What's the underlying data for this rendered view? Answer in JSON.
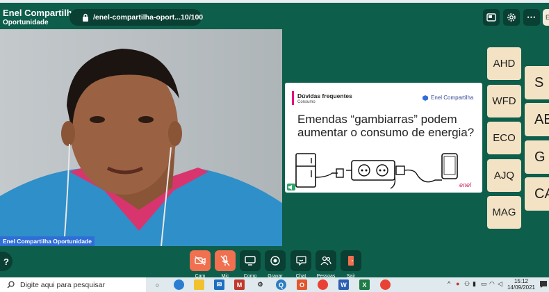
{
  "header": {
    "brand_title": "Enel Compartilha",
    "brand_subtitle": "Oportunidade",
    "url": "/enel-compartilha-oport...",
    "participant_count": "10/100",
    "edge_button_label": "E"
  },
  "video": {
    "name_tag": "Enel Compartilha Oportunidade"
  },
  "slide": {
    "section": "Dúvidas frequentes",
    "category": "Consumo",
    "logo_text": "Enel Compartilha",
    "heading": "Emendas “gambiarras” podem aumentar o consumo de energia?",
    "brand": "enel"
  },
  "participants": {
    "column1": [
      "AHD",
      "WFD",
      "ECO",
      "AJQ",
      "MAG"
    ],
    "column2": [
      "S",
      "AE",
      "G",
      "CA"
    ]
  },
  "controls": {
    "help": "?",
    "labels": [
      "Cam",
      "Mic",
      "Comp",
      "Gravar",
      "Chat",
      "Pessoas",
      "Sair"
    ]
  },
  "taskbar": {
    "search_placeholder": "Digite aqui para pesquisar",
    "time": "15:12",
    "date": "14/09/2021"
  },
  "colors": {
    "background": "#0e5e4c",
    "dark_button": "#0a3f33",
    "red_button": "#f07050",
    "tile": "#f3e3c4",
    "name_tag": "#2f6ed6"
  }
}
